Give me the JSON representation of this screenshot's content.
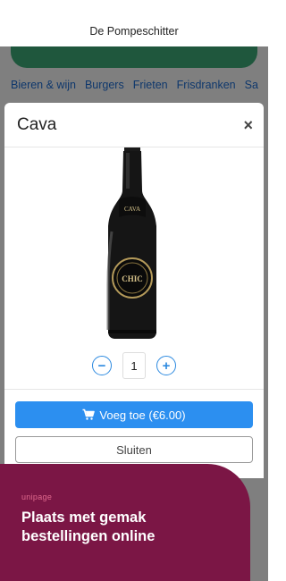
{
  "header": {
    "title": "De Pompeschitter"
  },
  "categories": [
    "Bieren & wijn",
    "Burgers",
    "Frieten",
    "Frisdranken",
    "Sa"
  ],
  "modal": {
    "title": "Cava",
    "close_symbol": "×",
    "product_image": {
      "icon": "cava-bottle-image",
      "label_text": "CHIC",
      "neck_text": "CAVA"
    },
    "quantity": {
      "decrement": "−",
      "value": "1",
      "increment": "+"
    },
    "add_button_label": "Voeg toe (€6.00)",
    "add_button_icon": "cart-icon",
    "close_button_label": "Sluiten"
  },
  "promo": {
    "logo": "unipage",
    "text": "Plaats met gemak bestellingen online"
  },
  "colors": {
    "accent": "#2c8ff0",
    "brand_green": "#3fae7a",
    "promo_bg": "#7b1645",
    "link": "#1d6fd8"
  }
}
